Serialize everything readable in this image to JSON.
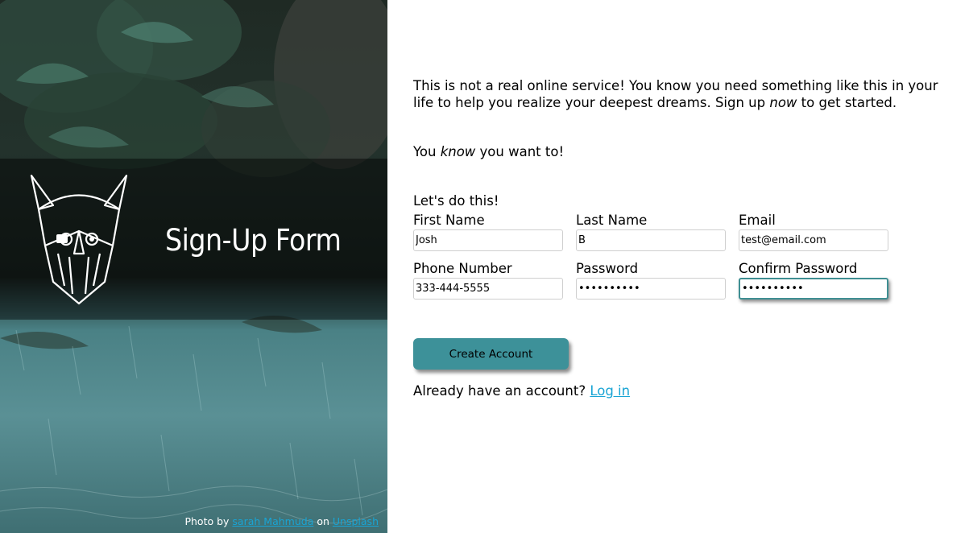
{
  "hero": {
    "title": "Sign-Up Form",
    "credit_prefix": "Photo by",
    "credit_author": "sarah Mahmuda",
    "credit_on": "on",
    "credit_site": "Unsplash"
  },
  "intro": {
    "line1_a": "This is not a real online service! You know you need something like this in your life to help you realize your deepest dreams. Sign up ",
    "line1_em": "now",
    "line1_b": " to get started.",
    "line2_a": "You ",
    "line2_em": "know",
    "line2_b": " you want to!",
    "lets": "Let's do this!"
  },
  "form": {
    "first_name_label": "First Name",
    "first_name_value": "Josh",
    "last_name_label": "Last Name",
    "last_name_value": "B",
    "email_label": "Email",
    "email_value": "test@email.com",
    "phone_label": "Phone Number",
    "phone_value": "333-444-5555",
    "password_label": "Password",
    "password_value": "••••••••••",
    "confirm_label": "Confirm Password",
    "confirm_value": "••••••••••",
    "submit_label": "Create Account"
  },
  "login": {
    "prompt": "Already have an account? ",
    "link": "Log in"
  },
  "colors": {
    "accent": "#3d9199",
    "link": "#19a4d4"
  }
}
